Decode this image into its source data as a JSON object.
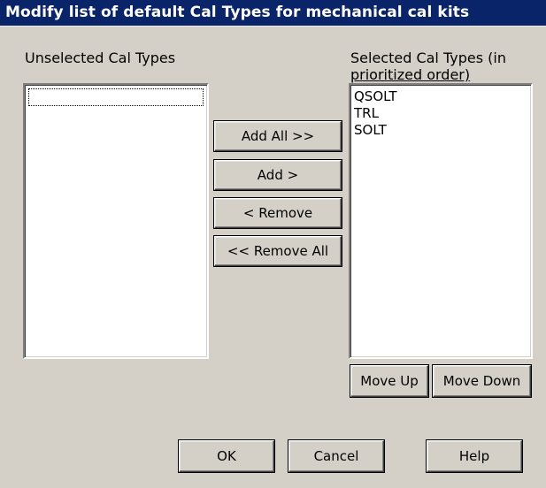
{
  "window": {
    "title": "Modify list of default Cal Types for mechanical cal kits"
  },
  "unselected": {
    "label": "Unselected Cal Types",
    "items": []
  },
  "selected": {
    "label_line1": "Selected Cal Types (in",
    "label_line2": "prioritized order)",
    "items": [
      "QSOLT",
      "TRL",
      "SOLT"
    ]
  },
  "transfer_buttons": {
    "add_all": "Add All >>",
    "add": "Add >",
    "remove": "< Remove",
    "remove_all": "<< Remove All"
  },
  "order_buttons": {
    "move_up": "Move Up",
    "move_down": "Move Down"
  },
  "dialog_buttons": {
    "ok": "OK",
    "cancel": "Cancel",
    "help": "Help"
  }
}
